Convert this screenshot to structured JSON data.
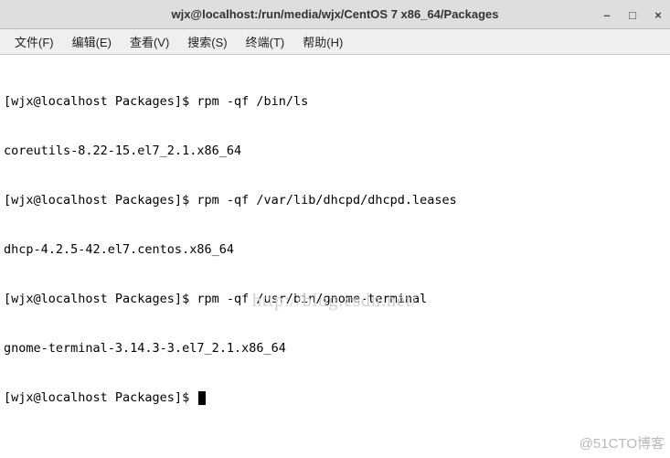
{
  "window": {
    "title": "wjx@localhost:/run/media/wjx/CentOS 7 x86_64/Packages",
    "minimize": "–",
    "maximize": "□",
    "close": "×"
  },
  "menu": {
    "file": "文件(F)",
    "edit": "编辑(E)",
    "view": "查看(V)",
    "search": "搜索(S)",
    "terminal": "终端(T)",
    "help": "帮助(H)"
  },
  "terminal": {
    "lines": [
      "[wjx@localhost Packages]$ rpm -qf /bin/ls",
      "coreutils-8.22-15.el7_2.1.x86_64",
      "[wjx@localhost Packages]$ rpm -qf /var/lib/dhcpd/dhcpd.leases",
      "dhcp-4.2.5-42.el7.centos.x86_64",
      "[wjx@localhost Packages]$ rpm -qf /usr/bin/gnome-terminal",
      "gnome-terminal-3.14.3-3.el7_2.1.x86_64"
    ],
    "prompt": "[wjx@localhost Packages]$ "
  },
  "watermarks": {
    "center": "http://blog.csdn.net/",
    "corner": "@51CTO博客"
  }
}
